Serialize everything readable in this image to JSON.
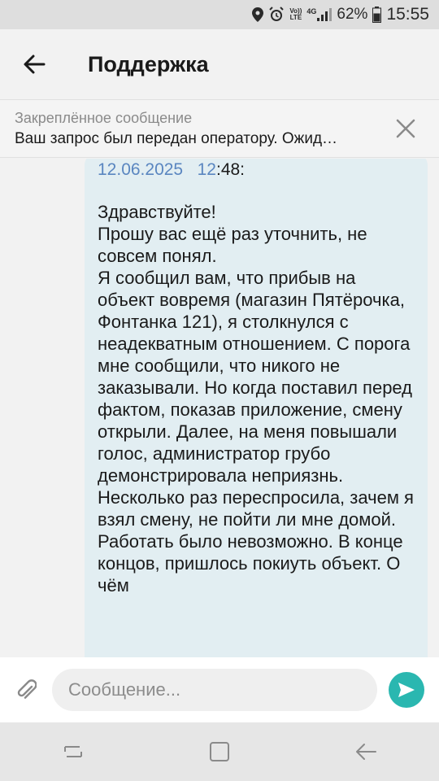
{
  "status_bar": {
    "volte_top": "Vo))",
    "volte_bottom": "LTE",
    "network": "4G",
    "battery": "62%",
    "time": "15:55",
    "icons": [
      "location-icon",
      "alarm-icon",
      "volte-icon",
      "signal-icon",
      "battery-icon"
    ]
  },
  "app_bar": {
    "title": "Поддержка",
    "back_icon": "arrow-left-icon"
  },
  "pinned": {
    "label": "Закреплённое сообщение",
    "text": "Ваш запрос был передан оператору. Ожид…",
    "close_icon": "close-icon"
  },
  "message": {
    "date": "12.06.2025",
    "time_hour": "12",
    "time_rest": ":48:",
    "body": "Здравствуйте!\nПрошу вас ещё раз уточнить, не совсем понял.\nЯ сообщил вам, что прибыв на объект вовремя (магазин Пятёрочка, Фонтанка 121), я столкнулся с неадекватным отношением. С порога мне сообщили, что никого не заказывали. Но когда поставил перед фактом, показав приложение, смену открыли. Далее, на меня повышали голос, администратор грубо демонстрировала неприязнь. Несколько раз переспросила, зачем я взял смену, не пойти ли мне домой. Работать было невозможно. В конце концов, пришлось покиуть объект. О чём"
  },
  "composer": {
    "placeholder": "Сообщение...",
    "attach_icon": "paperclip-icon",
    "send_icon": "send-icon",
    "send_color": "#2ab7b0"
  },
  "nav_bar": {
    "icons": [
      "recent-apps-icon",
      "home-icon",
      "back-icon"
    ]
  }
}
